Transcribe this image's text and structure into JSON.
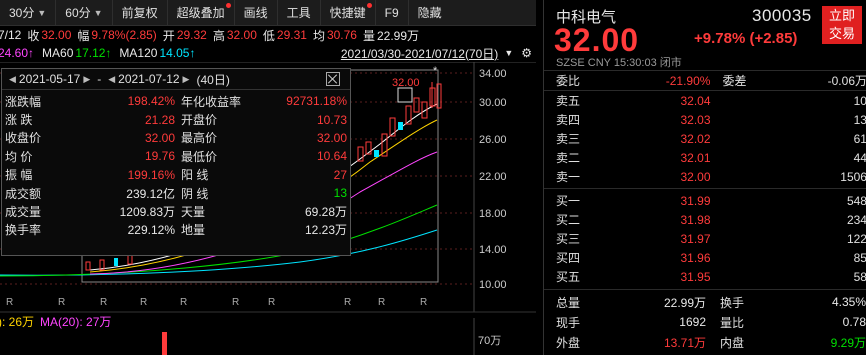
{
  "toolbar": {
    "items": [
      "30分",
      "60分",
      "前复权",
      "超级叠加",
      "画线",
      "工具",
      "快捷键",
      "F9",
      "隐藏"
    ]
  },
  "info": {
    "date": "7/12",
    "close_label": "收",
    "close": "32.00",
    "change_label": "幅",
    "change": "9.78%(2.85)",
    "open_label": "开",
    "open": "29.32",
    "high_label": "高",
    "high": "32.00",
    "low_label": "低",
    "low": "29.31",
    "ma_label": "均",
    "avg": "30.76",
    "vol_label": "量",
    "volume": "22.99万"
  },
  "ma_row": {
    "ma30_partial": "24.60↑",
    "ma60_label": "MA60",
    "ma60": "17.12↑",
    "ma120_label": "MA120",
    "ma120": "14.05↑",
    "range": "2021/03/30-2021/07/12(70日)"
  },
  "popup": {
    "start_date": "2021-05-17",
    "separator": "-",
    "end_date": "2021-07-12",
    "days": "(40日)",
    "rows": [
      {
        "l1": "涨跌幅",
        "v1": "198.42%",
        "l2": "年化收益率",
        "v2": "92731.18%",
        "c2": "red"
      },
      {
        "l1": "涨  跌",
        "v1": "21.28",
        "l2": "开盘价",
        "v2": "10.73",
        "c2": "red"
      },
      {
        "l1": "收盘价",
        "v1": "32.00",
        "l2": "最高价",
        "v2": "32.00",
        "c2": "red"
      },
      {
        "l1": "均  价",
        "v1": "19.76",
        "l2": "最低价",
        "v2": "10.64",
        "c2": "red"
      },
      {
        "l1": "振  幅",
        "v1": "199.16%",
        "l2": "阳  线",
        "v2": "27",
        "c2": "red"
      },
      {
        "l1": "成交额",
        "v1": "239.12亿",
        "l2": "阴  线",
        "v2": "13",
        "c2": "green"
      },
      {
        "l1": "成交量",
        "v1": "1209.83万",
        "l2": "天量",
        "v2": "69.28万",
        "c2": "white"
      },
      {
        "l1": "换手率",
        "v1": "229.12%",
        "l2": "地量",
        "v2": "12.23万",
        "c2": "white"
      }
    ]
  },
  "chart": {
    "y_ticks": [
      "34.00",
      "30.00",
      "26.00",
      "22.00",
      "18.00",
      "14.00",
      "10.00"
    ],
    "peak_label": "32.00",
    "star": "*",
    "r_markers": [
      "R",
      "R",
      "R",
      "R",
      "R",
      "R",
      "R",
      "R",
      "R",
      "R"
    ]
  },
  "volume": {
    "prefix": "): 26万",
    "ma20": "MA(20): 27万",
    "axis_label": "70万"
  },
  "right": {
    "name": "中科电气",
    "code": "300035",
    "trade_button": "立即交易",
    "trade_line1": "立即",
    "trade_line2": "交易",
    "price": "32.00",
    "change": "+9.78% (+2.85)",
    "sub": "SZSE  CNY  15:30:03  闭市",
    "weibi_label": "委比",
    "weibi": "-21.90%",
    "weicha_label": "委差",
    "weicha": "-0.06万",
    "asks": [
      {
        "label": "卖五",
        "price": "32.04",
        "vol": "10"
      },
      {
        "label": "卖四",
        "price": "32.03",
        "vol": "13"
      },
      {
        "label": "卖三",
        "price": "32.02",
        "vol": "61"
      },
      {
        "label": "卖二",
        "price": "32.01",
        "vol": "44"
      },
      {
        "label": "卖一",
        "price": "32.00",
        "vol": "1506"
      }
    ],
    "bids": [
      {
        "label": "买一",
        "price": "31.99",
        "vol": "548"
      },
      {
        "label": "买二",
        "price": "31.98",
        "vol": "234"
      },
      {
        "label": "买三",
        "price": "31.97",
        "vol": "122"
      },
      {
        "label": "买四",
        "price": "31.96",
        "vol": "85"
      },
      {
        "label": "买五",
        "price": "31.95",
        "vol": "58"
      }
    ],
    "stats": [
      {
        "l1": "总量",
        "v1": "22.99万",
        "l2": "换手",
        "v2": "4.35%",
        "c1": "white",
        "c2": "white"
      },
      {
        "l1": "现手",
        "v1": "1692",
        "l2": "量比",
        "v2": "0.78",
        "c1": "white",
        "c2": "white"
      },
      {
        "l1": "外盘",
        "v1": "13.71万",
        "l2": "内盘",
        "v2": "9.29万",
        "c1": "red",
        "c2": "green"
      }
    ]
  }
}
